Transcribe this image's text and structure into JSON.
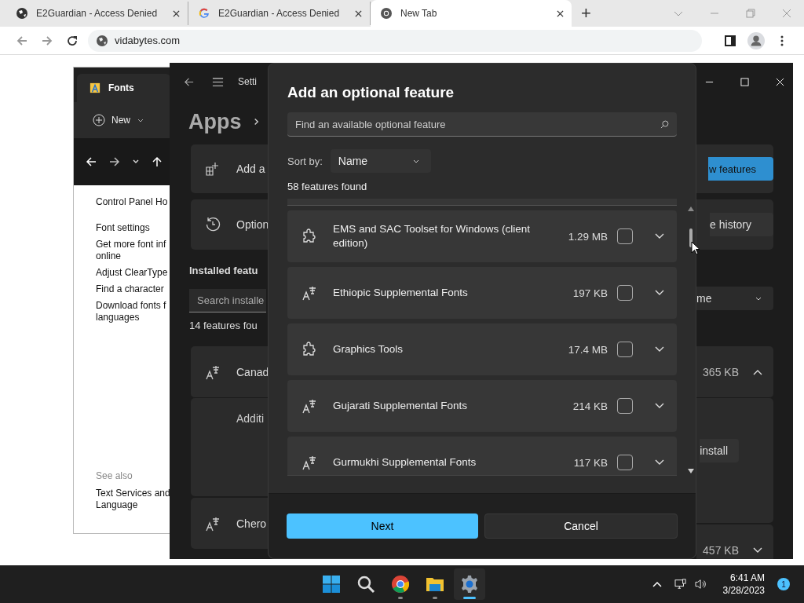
{
  "browser": {
    "tabs": [
      {
        "kind": "globe",
        "title": "E2Guardian - Access Denied",
        "selected": false
      },
      {
        "kind": "google",
        "title": "E2Guardian - Access Denied",
        "selected": false
      },
      {
        "kind": "chrome",
        "title": "New Tab",
        "selected": true
      }
    ],
    "new_tab": "+",
    "address": "vidabytes.com"
  },
  "fonts_window": {
    "title": "Fonts",
    "new_button": "New",
    "links": [
      {
        "lines": [
          "Control Panel Ho"
        ]
      },
      {
        "lines": [
          "Font settings"
        ]
      },
      {
        "lines": [
          "Get more font inf",
          "online"
        ]
      },
      {
        "lines": [
          "Adjust ClearType"
        ]
      },
      {
        "lines": [
          "Find a character"
        ]
      },
      {
        "lines": [
          "Download fonts f",
          "languages"
        ]
      }
    ],
    "see_also": "See also",
    "see_also_links": [
      {
        "lines": [
          "Text Services and",
          "Language"
        ]
      }
    ]
  },
  "settings": {
    "title": "Setti",
    "heading": "Apps",
    "add_card": "Add a",
    "add_button": "w features",
    "history_card": "Option",
    "history_button": "e history",
    "installed_heading": "Installed featu",
    "search_placeholder": "Search installe",
    "count": "14 features fou",
    "sort_value": "me",
    "installed": [
      {
        "name": "Canad",
        "size": "365 KB",
        "expanded": true,
        "detail": "Additi",
        "action": "install"
      },
      {
        "name": "Chero",
        "size": "457 KB",
        "expanded": false
      }
    ]
  },
  "dialog": {
    "title": "Add an optional feature",
    "search_placeholder": "Find an available optional feature",
    "sort_label": "Sort by:",
    "sort_value": "Name",
    "count": "58 features found",
    "features": [
      {
        "kind": "tool",
        "name": "EMS and SAC Toolset for Windows (client edition)",
        "size": "1.29 MB",
        "checked": false,
        "expanded": false
      },
      {
        "kind": "font",
        "name": "Ethiopic Supplemental Fonts",
        "size": "197 KB",
        "checked": false,
        "expanded": false
      },
      {
        "kind": "tool",
        "name": "Graphics Tools",
        "size": "17.4 MB",
        "checked": false,
        "expanded": false
      },
      {
        "kind": "font",
        "name": "Gujarati Supplemental Fonts",
        "size": "214 KB",
        "checked": false,
        "expanded": false
      },
      {
        "kind": "font",
        "name": "Gurmukhi Supplemental Fonts",
        "size": "117 KB",
        "checked": false,
        "expanded": false
      }
    ],
    "buttons": [
      {
        "label": "Next",
        "kind": "primary"
      },
      {
        "label": "Cancel",
        "kind": "secondary"
      }
    ]
  },
  "taskbar": {
    "apps": [
      {
        "kind": "start",
        "selected": false
      },
      {
        "kind": "search",
        "selected": false
      },
      {
        "kind": "chrome",
        "selected": false
      },
      {
        "kind": "folder",
        "selected": false
      },
      {
        "kind": "settings",
        "selected": true
      }
    ],
    "time": "6:41 AM",
    "date": "3/28/2023",
    "badge": "1"
  }
}
